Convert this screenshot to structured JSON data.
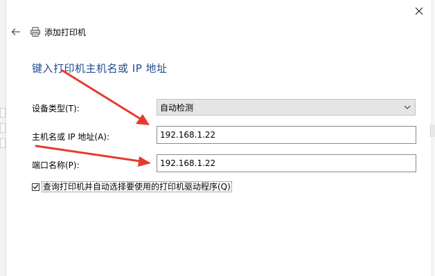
{
  "window": {
    "title": "添加打印机",
    "heading": "键入打印机主机名或 IP 地址"
  },
  "icons": [
    "close-icon",
    "back-arrow-icon",
    "printer-icon",
    "chevron-down-icon",
    "checkmark-icon"
  ],
  "form": {
    "device_type_label": "设备类型(T):",
    "device_type_value": "自动检测",
    "host_label": "主机名或 IP 地址(A):",
    "host_value": "192.168.1.22",
    "port_label": "端口名称(P):",
    "port_value": "192.168.1.22",
    "query_checkbox_label": "查询打印机并自动选择要使用的打印机驱动程序(Q)",
    "query_checked": true
  },
  "colors": {
    "heading": "#1f4e8c",
    "annotation_arrow": "#e53b2c",
    "select_bg": "#e5e5e5"
  }
}
